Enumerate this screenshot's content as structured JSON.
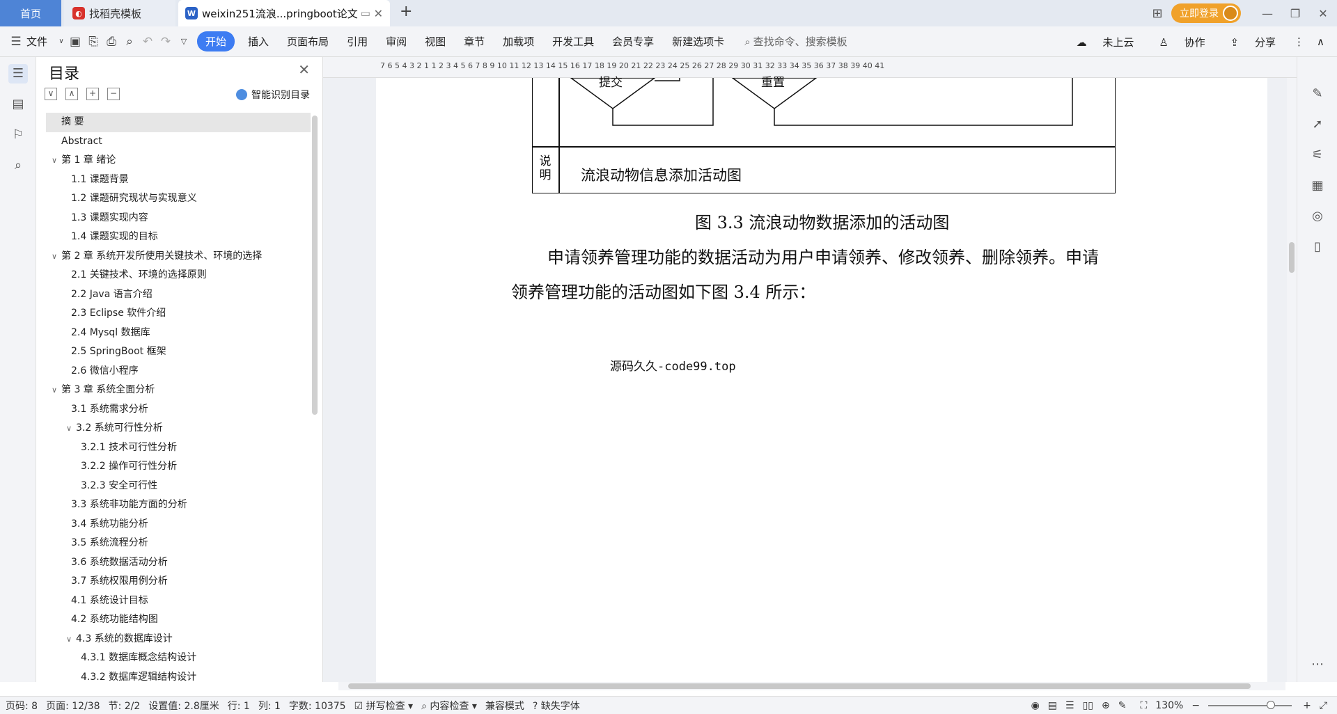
{
  "tabs": {
    "home": "首页",
    "template": "找稻壳模板",
    "doc": "weixin251流浪...pringboot论文"
  },
  "header": {
    "login": "立即登录"
  },
  "menu": {
    "file": "文件",
    "items": [
      "开始",
      "插入",
      "页面布局",
      "引用",
      "审阅",
      "视图",
      "章节",
      "加载项",
      "开发工具",
      "会员专享",
      "新建选项卡"
    ],
    "search_placeholder": "查找命令、搜索模板",
    "cloud": "未上云",
    "collab": "协作",
    "share": "分享"
  },
  "toc": {
    "title": "目录",
    "smart": "智能识别目录",
    "items": [
      {
        "label": "摘  要",
        "indent": 1,
        "chev": ""
      },
      {
        "label": "Abstract",
        "indent": 1,
        "chev": ""
      },
      {
        "label": "第 1 章  绪论",
        "indent": 0,
        "chev": "∨"
      },
      {
        "label": "1.1 课题背景",
        "indent": 2,
        "chev": ""
      },
      {
        "label": "1.2 课题研究现状与实现意义",
        "indent": 2,
        "chev": ""
      },
      {
        "label": "1.3 课题实现内容",
        "indent": 2,
        "chev": ""
      },
      {
        "label": "1.4 课题实现的目标",
        "indent": 2,
        "chev": ""
      },
      {
        "label": "第 2 章  系统开发所使用关键技术、环境的选择",
        "indent": 0,
        "chev": "∨"
      },
      {
        "label": "2.1 关键技术、环境的选择原则",
        "indent": 2,
        "chev": ""
      },
      {
        "label": "2.2 Java 语言介绍",
        "indent": 2,
        "chev": ""
      },
      {
        "label": "2.3 Eclipse 软件介绍",
        "indent": 2,
        "chev": ""
      },
      {
        "label": "2.4 Mysql 数据库",
        "indent": 2,
        "chev": ""
      },
      {
        "label": "2.5 SpringBoot 框架",
        "indent": 2,
        "chev": ""
      },
      {
        "label": "2.6 微信小程序",
        "indent": 2,
        "chev": ""
      },
      {
        "label": "第 3 章  系统全面分析",
        "indent": 0,
        "chev": "∨"
      },
      {
        "label": "3.1 系统需求分析",
        "indent": 2,
        "chev": ""
      },
      {
        "label": "3.2 系统可行性分析",
        "indent": 1.5,
        "chev": "∨"
      },
      {
        "label": "3.2.1 技术可行性分析",
        "indent": 3,
        "chev": ""
      },
      {
        "label": "3.2.2 操作可行性分析",
        "indent": 3,
        "chev": ""
      },
      {
        "label": "3.2.3 安全可行性",
        "indent": 3,
        "chev": ""
      },
      {
        "label": "3.3 系统非功能方面的分析",
        "indent": 2,
        "chev": ""
      },
      {
        "label": "3.4 系统功能分析",
        "indent": 2,
        "chev": ""
      },
      {
        "label": "3.5 系统流程分析",
        "indent": 2,
        "chev": ""
      },
      {
        "label": "3.6 系统数据活动分析",
        "indent": 2,
        "chev": ""
      },
      {
        "label": "3.7 系统权限用例分析",
        "indent": 2,
        "chev": ""
      },
      {
        "label": "4.1 系统设计目标",
        "indent": 2,
        "chev": ""
      },
      {
        "label": "4.2 系统功能结构图",
        "indent": 2,
        "chev": ""
      },
      {
        "label": "4.3 系统的数据库设计",
        "indent": 1.5,
        "chev": "∨"
      },
      {
        "label": "4.3.1 数据库概念结构设计",
        "indent": 3,
        "chev": ""
      },
      {
        "label": "4.3.2 数据库逻辑结构设计",
        "indent": 3,
        "chev": ""
      }
    ]
  },
  "ruler": "7    6    5    4    3    2    1         1    2    3    4    5    6    7    8    9   10   11   12   13   14   15   16   17   18   19   20   21   22   23   24   25   26   27   28   29   30   31   32   33   34   35   36   37   38   39   40   41",
  "doc": {
    "diagram_labels": [
      "提交",
      "重置"
    ],
    "desc_label": "说明",
    "desc_text": "流浪动物信息添加活动图",
    "caption": "图 3.3 流浪动物数据添加的活动图",
    "para_line1": "申请领养管理功能的数据活动为用户申请领养、修改领养、删除领养。申请",
    "para_line2": "领养管理功能的活动图如下图 3.4 所示：",
    "watermark": "源码久久-code99.top"
  },
  "status": {
    "page": "页码: 8",
    "pages": "页面: 12/38",
    "section": "节: 2/2",
    "setting": "设置值: 2.8厘米",
    "row": "行: 1",
    "col": "列: 1",
    "words": "字数: 10375",
    "spell": "拼写检查",
    "content": "内容检查",
    "compat": "兼容模式",
    "missing_font": "缺失字体",
    "zoom": "130%"
  }
}
